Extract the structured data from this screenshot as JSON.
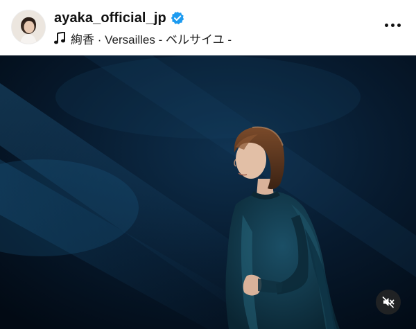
{
  "post": {
    "username": "ayaka_official_jp",
    "verified": true,
    "music": {
      "icon": "music-note-icon",
      "label": "絢香 · Versailles - ベルサイユ -"
    },
    "more_icon": "more-options-icon",
    "media": {
      "mute_icon": "speaker-muted-icon"
    }
  },
  "colors": {
    "verified_blue": "#1d9bf0",
    "text_primary": "#111111",
    "stage_dark": "#05111f",
    "spotlight": "#1e5b86"
  }
}
